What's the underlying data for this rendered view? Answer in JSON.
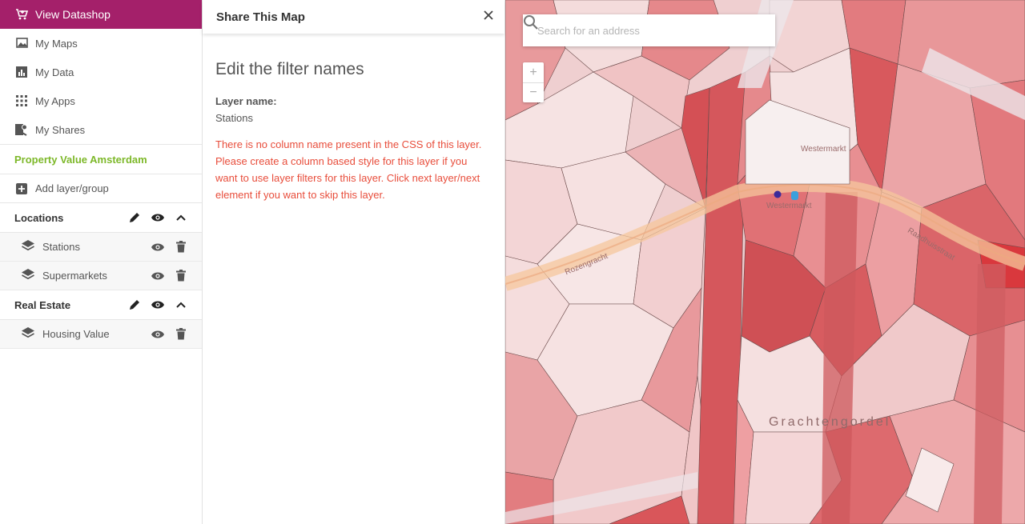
{
  "sidebar": {
    "datashop_label": "View Datashop",
    "nav": [
      {
        "label": "My Maps",
        "icon": "maps-icon"
      },
      {
        "label": "My Data",
        "icon": "data-icon"
      },
      {
        "label": "My Apps",
        "icon": "apps-icon"
      },
      {
        "label": "My Shares",
        "icon": "shares-icon"
      }
    ],
    "map_title": "Property Value Amsterdam",
    "add_layer_label": "Add layer/group",
    "groups": [
      {
        "name": "Locations",
        "layers": [
          {
            "name": "Stations"
          },
          {
            "name": "Supermarkets"
          }
        ]
      },
      {
        "name": "Real Estate",
        "layers": [
          {
            "name": "Housing Value"
          }
        ]
      }
    ]
  },
  "panel": {
    "title": "Share This Map",
    "heading": "Edit the filter names",
    "layer_label": "Layer name:",
    "layer_value": "Stations",
    "error": "There is no column name present in the CSS of this layer. Please create a column based style for this layer if you want to use layer filters for this layer. Click next layer/next element if you want to skip this layer."
  },
  "map": {
    "search_placeholder": "Search for an address",
    "zoom_in": "+",
    "zoom_out": "−",
    "labels": {
      "westermarkt_1": "Westermarkt",
      "westermarkt_2": "Westermarkt",
      "rozengracht": "Rozengracht",
      "raadhuisstraat": "Raadhuisstraat",
      "district": "Grachtengordel"
    },
    "colors": {
      "accent": "#a4206a",
      "green": "#7db829",
      "error": "#e84d3b"
    }
  }
}
